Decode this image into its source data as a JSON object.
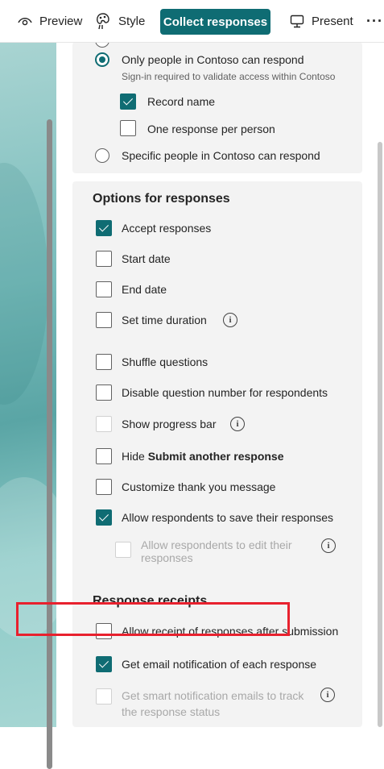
{
  "toolbar": {
    "preview_label": "Preview",
    "style_label": "Style",
    "collect_label": "Collect responses",
    "present_label": "Present",
    "more_label": "···",
    "accent_color": "#0f6c73"
  },
  "who_can_respond": {
    "options": [
      {
        "label": "Only people in Contoso can respond",
        "selected": true,
        "sub": "Sign-in required to validate access within Contoso",
        "children": [
          {
            "label": "Record name",
            "checked": true
          },
          {
            "label": "One response per person",
            "checked": false
          }
        ]
      },
      {
        "label": "Specific people in Contoso can respond",
        "selected": false
      }
    ]
  },
  "options_for_responses": {
    "heading": "Options for responses",
    "items": [
      {
        "label": "Accept responses",
        "checked": true
      },
      {
        "label": "Start date",
        "checked": false
      },
      {
        "label": "End date",
        "checked": false
      },
      {
        "label": "Set time duration",
        "checked": false,
        "info": true
      },
      {
        "label": "Shuffle questions",
        "checked": false
      },
      {
        "label": "Disable question number for respondents",
        "checked": false
      },
      {
        "label": "Show progress bar",
        "checked": false,
        "info": true
      },
      {
        "label_prefix": "Hide ",
        "label_bold": "Submit another response",
        "checked": false
      },
      {
        "label": "Customize thank you message",
        "checked": false
      },
      {
        "label": "Allow respondents to save their responses",
        "checked": true
      },
      {
        "label": "Allow respondents to edit their responses",
        "checked": false,
        "disabled": true,
        "info": true
      }
    ]
  },
  "response_receipts": {
    "heading": "Response receipts",
    "items": [
      {
        "label": "Allow receipt of responses after submission",
        "checked": false
      },
      {
        "label": "Get email notification of each response",
        "checked": true,
        "highlighted": true
      },
      {
        "label": "Get smart notification emails to track the response status",
        "checked": false,
        "disabled": true,
        "info": true
      }
    ]
  },
  "info_glyph": "i",
  "highlight_color": "#e8212e"
}
